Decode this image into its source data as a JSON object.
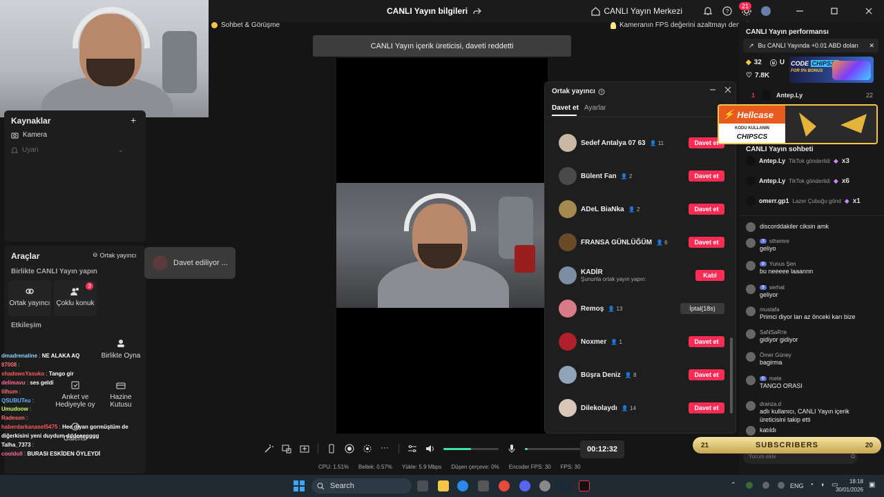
{
  "window": {
    "title": "CANLI Yayın bilgileri",
    "live_center": "CANLI Yayın Merkezi",
    "notif_count": "21"
  },
  "tips": {
    "chat_chip": "Sohbet & Görüşme",
    "fps_tip": "Kameranın FPS değerini azaltmayı deneyin",
    "toast": "CANLI Yayın içerik üreticisi, daveti reddetti"
  },
  "sources": {
    "title": "Kaynaklar",
    "items": [
      "Kamera",
      "Uyarı"
    ]
  },
  "tools": {
    "title": "Araçlar",
    "cohost_link": "Ortak yayıncı",
    "section_live": "Birlikte CANLI Yayın yapın",
    "tile_cohost": "Ortak yayıncı",
    "tile_multiguest": "Çoklu konuk",
    "multiguest_badge": "3",
    "section_interaction": "Etkileşim",
    "tile_play_together": "Birlikte Oyna",
    "tile_poll": "Anket ve Hediyeyle oy",
    "tile_treasure": "Hazine Kutusu",
    "tile_gallery": "Galerisi"
  },
  "overlay_chat": [
    {
      "user": "dmadrenaline",
      "text": "NE ALAKA AQ",
      "color": "#8fd3ff"
    },
    {
      "user": "87008",
      "text": "",
      "color": "#ff6b6b"
    },
    {
      "user": "shadowsYasuko",
      "text": "Tango gir",
      "color": "#ff5a5a"
    },
    {
      "user": "delimavu",
      "text": "ses geldi",
      "color": "#ff6b9a"
    },
    {
      "user": "lilhum",
      "text": "",
      "color": "#ff6b6b"
    },
    {
      "user": "QSUBUTeu",
      "text": "",
      "color": "#66b3ff"
    },
    {
      "user": "Umudoow",
      "text": "",
      "color": "#c8ff66"
    },
    {
      "user": "Radeson",
      "text": "",
      "color": "#ff6b6b"
    },
    {
      "user": "haberdarkanasel5475",
      "text": "Hee diyan gormüştüm de",
      "color": "#ff5a5a"
    },
    {
      "user": "",
      "text": "diğerkisini yeni duydum dddeeegggg",
      "color": "#ffffff"
    },
    {
      "user": "Talha_7373",
      "text": "",
      "color": "#ffffff"
    },
    {
      "user": "cooldoll",
      "text": "BURASI ESKİDEN ÖYLEYDİ",
      "color": "#ff6b9a"
    }
  ],
  "inviting": "Davet ediliyor ...",
  "cohost": {
    "title": "Ortak yayıncı",
    "tab_invite": "Davet et",
    "tab_settings": "Ayarlar",
    "rows": [
      {
        "name": "Sedef Antalya 07 63",
        "count": "11",
        "action": "Davet et",
        "kind": "invite",
        "color": "#c9b8a4"
      },
      {
        "name": "Bülent Fan",
        "count": "2",
        "action": "Davet et",
        "kind": "invite",
        "color": "#4a4a4a"
      },
      {
        "name": "ADeL BiaNka",
        "count": "2",
        "action": "Davet et",
        "kind": "invite",
        "color": "#a58a4f"
      },
      {
        "name": "FRANSA GÜNLÜĞÜM",
        "count": "6",
        "action": "Davet et",
        "kind": "invite",
        "color": "#6b4a2a"
      },
      {
        "name": "KADİR",
        "count": "",
        "sub": "Şununla ortak yayın yapın:",
        "action": "Katıl",
        "kind": "join",
        "color": "#7b8ea3"
      },
      {
        "name": "Remoş",
        "count": "13",
        "action": "İptal(18s)",
        "kind": "cancel",
        "color": "#d97a8a"
      },
      {
        "name": "Noxmer",
        "count": "1",
        "action": "Davet et",
        "kind": "invite",
        "color": "#b0202a"
      },
      {
        "name": "Büşra Deniz",
        "count": "8",
        "action": "Davet et",
        "kind": "invite",
        "color": "#8fa4b8"
      },
      {
        "name": "Dilekolaydı",
        "count": "14",
        "action": "Davet et",
        "kind": "invite",
        "color": "#d8c6b6"
      }
    ]
  },
  "toolbar": {
    "timer": "00:12:32"
  },
  "stats": {
    "cpu": "CPU: 1.51%",
    "memory": "Bellek: 0.57%",
    "upload": "Yükle: 5.9 Mbps",
    "dropped": "Düşen çerçeve: 0%",
    "encoder_fps": "Encoder FPS: 30",
    "fps": "FPS: 30"
  },
  "right": {
    "perf_title": "CANLI Yayın performansı",
    "perf_notice": "Bu CANLI Yayında +0.01 ABD doları",
    "diamonds": "32",
    "viewers_short": "U",
    "likes": "7.8K",
    "rank_num": "1",
    "rank_name": "Antep.Ly",
    "rank_count": "22",
    "chat_title": "CANLI Yayın sohbeti",
    "gifts": [
      {
        "user": "Antep.Ly",
        "text": "TikTok gönderildi",
        "mult": "x3"
      },
      {
        "user": "Antep.Ly",
        "text": "TikTok gönderildi",
        "mult": "x6"
      },
      {
        "user": "omerr.gp1",
        "text": "Lazer Çubuğu gönd",
        "mult": "x1"
      }
    ],
    "messages": [
      {
        "name": "",
        "lvl": "",
        "lvl2": "",
        "text": "discorddakiler ciksin amk"
      },
      {
        "name": "sthemre",
        "lvl": "3",
        "lvl2": "",
        "text": "geliyo"
      },
      {
        "name": "Yunus Şen",
        "lvl": "8",
        "lvl2": "",
        "text": "bu neeeee laaannn"
      },
      {
        "name": "serhat",
        "lvl": "9",
        "lvl2": "",
        "text": "geliyor"
      },
      {
        "name": "mustafa",
        "lvl": "",
        "lvl2": "",
        "text": "Primci diyor lan az önceki karı bize"
      },
      {
        "name": "SaNSaRᴛʀ",
        "lvl": "",
        "lvl2": "",
        "text": "gidiyor gidiyor"
      },
      {
        "name": "Ömer Güney",
        "lvl": "",
        "lvl2": "",
        "text": "bagirma"
      },
      {
        "name": "mete",
        "lvl": "6",
        "lvl2": "",
        "text": "TANGO ORASI"
      },
      {
        "name": "dranza.d",
        "lvl": "",
        "lvl2": "",
        "text": "adlı kullanıcı, CANLI Yayın içerik üreticisini takip etti"
      },
      {
        "name": "",
        "lvl": "",
        "lvl2": "",
        "text": "katıldı"
      }
    ],
    "comment_placeholder": "Yorum ekle"
  },
  "promo": {
    "code_banner_title": "CODE",
    "code_banner_code": "CHIPS31",
    "code_banner_bonus": "FOR 5% BONUS",
    "hellcase_brand": "Hellcase",
    "hellcase_small": "KODU KULLANIN",
    "hellcase_code": "CHIPSCS",
    "subs_left": "21",
    "subs_label": "SUBSCRIBERS",
    "subs_right": "20"
  },
  "taskbar": {
    "search": "Search",
    "lang": "ENG",
    "time": "18:18",
    "date": "30/01/2026"
  },
  "colors": {
    "accent": "#fe2c55",
    "panel": "#1d1d1d"
  }
}
